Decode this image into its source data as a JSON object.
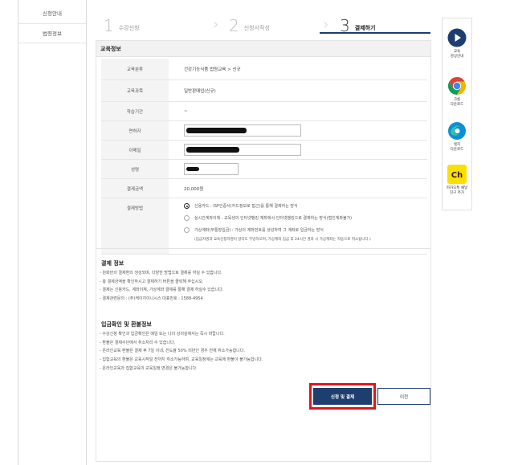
{
  "sidebar": {
    "items": [
      {
        "label": "신청안내"
      },
      {
        "label": "법령정보"
      }
    ]
  },
  "steps": [
    {
      "num": "1",
      "label": "수강신청"
    },
    {
      "num": "2",
      "label": "신청서작성"
    },
    {
      "num": "3",
      "label": "결제하기"
    }
  ],
  "section": {
    "title": "교육정보"
  },
  "form": {
    "rows": [
      {
        "label": "교육분류",
        "value": "건강기능식품 법령교육 > 신규"
      },
      {
        "label": "교육과목",
        "value": "일반판매업(신규)"
      },
      {
        "label": "학습기간",
        "value": "~"
      },
      {
        "label": "면허자",
        "value": ""
      },
      {
        "label": "이메일",
        "value": ""
      },
      {
        "label": "성명",
        "value": ""
      },
      {
        "label": "결제금액",
        "value": "20,000원"
      },
      {
        "label": "결제방법",
        "value": ""
      }
    ],
    "payment_options": [
      {
        "label": "신용카드 : ISP인증서(카드정보로 접근)를 통해 결제하는 방식",
        "checked": true
      },
      {
        "label": "실시간계좌이체 : 교육생의 인터넷뱅킹 계좌에서 인터넷뱅킹으로 결제하는 방식(법인계좌불가)",
        "checked": false
      },
      {
        "label": "가상계좌(무통장입금) : 가상의 계좌번호를 생성하여 그 계좌로 입금하는 방식",
        "checked": false
      }
    ],
    "virtual_note": "(입금자명과 교육신청자명이 달라도 무방하오며, 가상계좌 입금 후 24시간 경과 시 가상계좌는 자동으로 취소됩니다.)"
  },
  "payment_info": {
    "title": "결제 정보",
    "items": [
      "- 원화만의 결제환의 생성되며, 다양한 방법으로 결제를 하실 수 있습니다.",
      "- 총 결제금액을 확인하시고 결제하기 버튼을 클릭해 주십시오.",
      "- 결제는 신용카드, 계좌이체, 가상계좌 결제를 통해 결제 하실수 있습니다.",
      "- 결제관련문의 : (주)케이지이니시스 대표번호 : 1588-4954"
    ]
  },
  "refund_info": {
    "title": "입금확인 및 환불정보",
    "items": [
      "- 수강신청 확인과 입금확인은 매일 또는 나의 강의실에서는 즉시 바랍니다.",
      "- 환불은 결제수단에서 취소처리 수 있습니다.",
      "- 온라인교육 환불은 결제 후 7일 이내, 진도율 50% 미만인 경우 전체 취소가능합니다.",
      "- 집합교육의 환불은 교육시작일 전까지 취소가능하며, 교육일정에는 교육에 환불이 불가능합니다.",
      "- 온라인교육과 집합교육의 교육일정 변경은 불가능합니다."
    ]
  },
  "buttons": {
    "submit": "신청 및 결제",
    "prev": "이전"
  },
  "quick_menu": [
    {
      "label": "교육\n영상안내",
      "icon": "play-icon"
    },
    {
      "label": "크롬\n다운로드",
      "icon": "chrome-icon"
    },
    {
      "label": "엣지\n다운로드",
      "icon": "edge-icon"
    },
    {
      "label": "카카오톡 채널\n친구 추가",
      "icon": "kakao-channel-icon"
    }
  ],
  "colors": {
    "accent": "#1d3e6f",
    "highlight": "#e2141e",
    "kakao": "#f9e000"
  }
}
